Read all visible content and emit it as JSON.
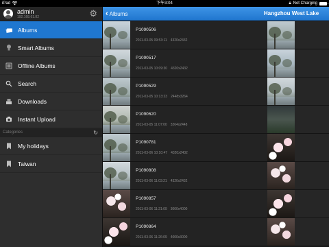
{
  "status_bar": {
    "carrier": "iPad",
    "wifi_icon": "wifi-icon",
    "time": "下午3:04",
    "charging": "Not Charging",
    "battery_level": 0.95
  },
  "sidebar": {
    "profile": {
      "username": "admin",
      "ip": "192.168.61.82"
    },
    "items": [
      {
        "label": "Albums",
        "icon": "albums-icon",
        "active": true
      },
      {
        "label": "Smart Albums",
        "icon": "lightbulb-icon",
        "active": false
      },
      {
        "label": "Offline Albums",
        "icon": "offline-icon",
        "active": false
      },
      {
        "label": "Search",
        "icon": "search-icon",
        "active": false
      },
      {
        "label": "Downloads",
        "icon": "downloads-icon",
        "active": false
      },
      {
        "label": "Instant Upload",
        "icon": "upload-icon",
        "active": false
      }
    ],
    "categories_header": "Categories",
    "categories": [
      {
        "label": "My holidays",
        "icon": "bookmark-icon"
      },
      {
        "label": "Taiwan",
        "icon": "bookmark-icon"
      }
    ]
  },
  "navbar": {
    "back_label": "Albums",
    "title": "Hangzhou West Lake"
  },
  "photos": {
    "left": [
      {
        "name": "P1090506",
        "date": "2011-03-05 09:53:11",
        "dims": "4320x2432"
      },
      {
        "name": "P1090517",
        "date": "2011-03-05 10:09:30",
        "dims": "4320x2432"
      },
      {
        "name": "P1090529",
        "date": "2011-03-05 10:13:23",
        "dims": "2448x3264"
      },
      {
        "name": "P1090620",
        "date": "2011-03-05 11:07:00",
        "dims": "3264x2448"
      },
      {
        "name": "P1090781",
        "date": "2011-03-06 10:10:47",
        "dims": "4320x2432"
      },
      {
        "name": "P1090808",
        "date": "2011-03-06 11:03:21",
        "dims": "4320x2432"
      },
      {
        "name": "P1090857",
        "date": "2011-03-06 11:21:09",
        "dims": "3000x4000"
      },
      {
        "name": "P1090864",
        "date": "2011-03-06 11:26:09",
        "dims": "4000x3000"
      }
    ],
    "right": [
      {
        "name": "P1090509",
        "date": "2011-03-05 09:5"
      },
      {
        "name": "P1090520",
        "date": "2011-03-05 10:1"
      },
      {
        "name": "P1090537",
        "date": "2011-03-05 10:1"
      },
      {
        "name": "P1090700",
        "date": "2011-03-05 20:1"
      },
      {
        "name": "P1090801",
        "date": "2011-03-06 10:4"
      },
      {
        "name": "P1090855",
        "date": "2011-03-06 11:2"
      },
      {
        "name": "P1090862",
        "date": "2011-03-06 11:2"
      },
      {
        "name": "P1100372",
        "date": "2011-03-07 15"
      }
    ]
  }
}
